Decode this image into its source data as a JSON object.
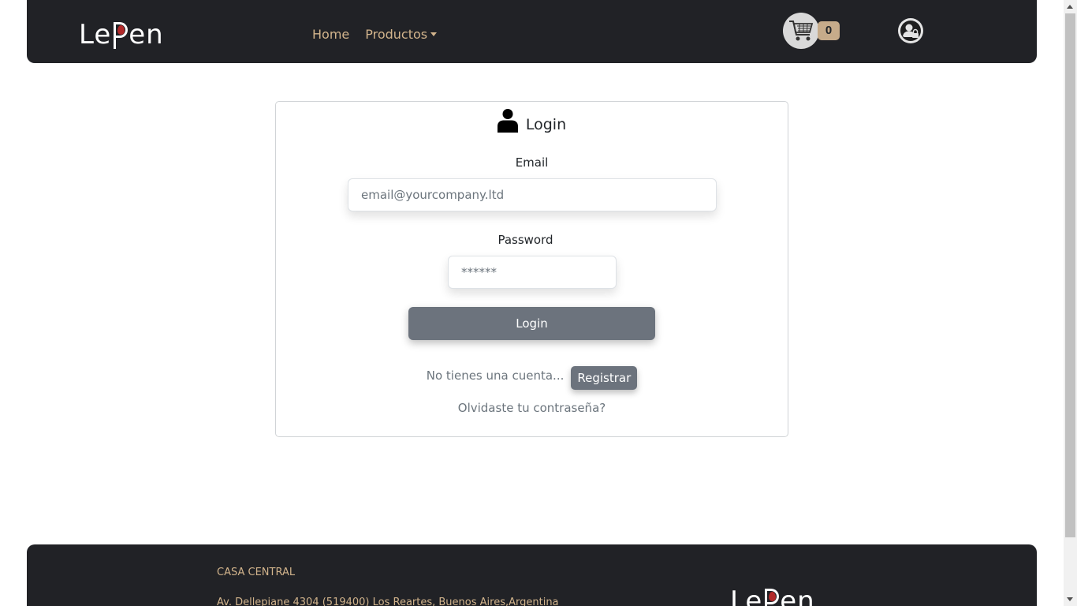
{
  "navbar": {
    "logo_left": "Le",
    "logo_right": "en",
    "links": [
      {
        "label": "Home"
      },
      {
        "label": "Productos"
      }
    ],
    "cart_count": "0",
    "cart_icon": "shopping-cart-icon",
    "user_icon": "user-lock-icon"
  },
  "login": {
    "title": "Login",
    "title_icon": "user-icon",
    "email_label": "Email",
    "email_placeholder": "email@yourcompany.ltd",
    "email_value": "",
    "password_label": "Password",
    "password_placeholder": "******",
    "password_value": "",
    "submit_label": "Login",
    "register_prompt": "No tienes una cuenta...",
    "register_label": "Registrar",
    "forgot_label": "Olvidaste tu contraseña?"
  },
  "footer": {
    "heading": "CASA CENTRAL",
    "address": "Av. Dellepiane 4304 (519400) Los Reartes, Buenos Aires,Argentina",
    "logo_left": "Le",
    "logo_right": "en"
  },
  "colors": {
    "navbar_bg": "#212226",
    "accent": "#d2b48c",
    "button_gray": "#6c737d",
    "logo_flame": "#b22a2a"
  }
}
